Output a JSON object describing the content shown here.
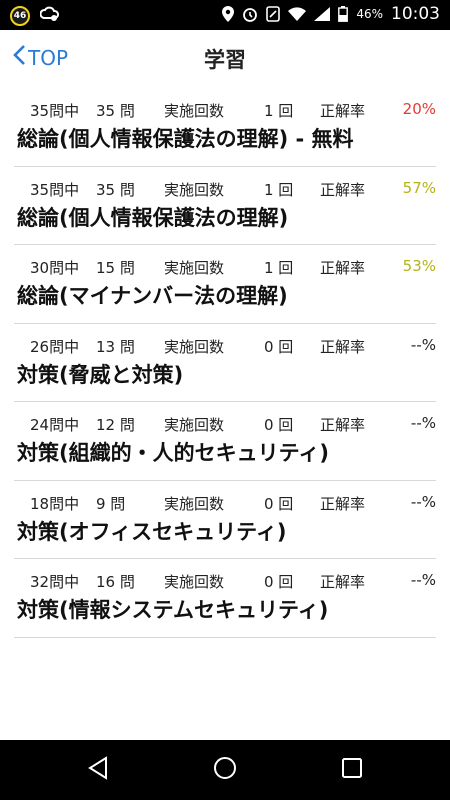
{
  "status_bar": {
    "badge": "46",
    "battery": "46%",
    "time": "10:03"
  },
  "header": {
    "back_label": "TOP",
    "title": "学習"
  },
  "labels": {
    "attempts_label": "実施回数",
    "rate_label": "正解率"
  },
  "colors": {
    "accent": "#2a7ad6",
    "rate_low": "#e53935",
    "rate_mid": "#b5b31a",
    "rate_none": "#222222"
  },
  "items": [
    {
      "total": "35問中",
      "done": "35 問",
      "attempts": "1 回",
      "rate": "20%",
      "rate_color": "#e53935",
      "title": "総論(個人情報保護法の理解) - 無料"
    },
    {
      "total": "35問中",
      "done": "35 問",
      "attempts": "1 回",
      "rate": "57%",
      "rate_color": "#b5b31a",
      "title": "総論(個人情報保護法の理解)"
    },
    {
      "total": "30問中",
      "done": "15 問",
      "attempts": "1 回",
      "rate": "53%",
      "rate_color": "#b5b31a",
      "title": "総論(マイナンバー法の理解)"
    },
    {
      "total": "26問中",
      "done": "13 問",
      "attempts": "0 回",
      "rate": "--%",
      "rate_color": "#222222",
      "title": "対策(脅威と対策)"
    },
    {
      "total": "24問中",
      "done": "12 問",
      "attempts": "0 回",
      "rate": "--%",
      "rate_color": "#222222",
      "title": "対策(組織的・人的セキュリティ)"
    },
    {
      "total": "18問中",
      "done": "9 問",
      "attempts": "0 回",
      "rate": "--%",
      "rate_color": "#222222",
      "title": "対策(オフィスセキュリティ)"
    },
    {
      "total": "32問中",
      "done": "16 問",
      "attempts": "0 回",
      "rate": "--%",
      "rate_color": "#222222",
      "title": "対策(情報システムセキュリティ)"
    }
  ]
}
